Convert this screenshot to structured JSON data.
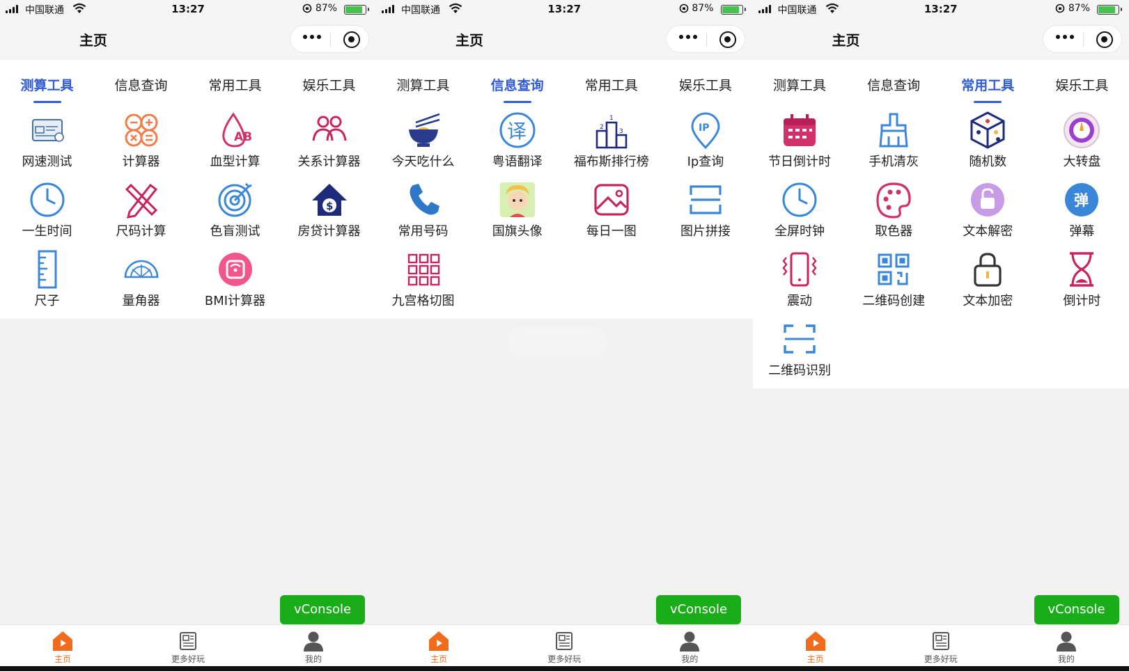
{
  "status_bar": {
    "carrier": "中国联通",
    "time": "13:27",
    "battery": "87%"
  },
  "nav": {
    "title": "主页"
  },
  "tabs": [
    "测算工具",
    "信息查询",
    "常用工具",
    "娱乐工具"
  ],
  "tabbar": {
    "home": "主页",
    "more": "更多好玩",
    "mine": "我的"
  },
  "vconsole": "vConsole",
  "colors": {
    "accent": "#2f5ad8",
    "orange": "#f26b1d",
    "green": "#1aad19"
  },
  "screens": [
    {
      "active_tab": 0,
      "items": [
        {
          "label": "网速测试",
          "icon": "speed-test-icon"
        },
        {
          "label": "计算器",
          "icon": "calculator-icon"
        },
        {
          "label": "血型计算",
          "icon": "blood-type-icon"
        },
        {
          "label": "关系计算器",
          "icon": "relation-icon"
        },
        {
          "label": "一生时间",
          "icon": "clock-icon"
        },
        {
          "label": "尺码计算",
          "icon": "pencil-ruler-icon"
        },
        {
          "label": "色盲测试",
          "icon": "target-icon"
        },
        {
          "label": "房贷计算器",
          "icon": "house-loan-icon"
        },
        {
          "label": "尺子",
          "icon": "ruler-icon"
        },
        {
          "label": "量角器",
          "icon": "protractor-icon"
        },
        {
          "label": "BMI计算器",
          "icon": "scale-icon"
        }
      ]
    },
    {
      "active_tab": 1,
      "items": [
        {
          "label": "今天吃什么",
          "icon": "bowl-icon"
        },
        {
          "label": "粤语翻译",
          "icon": "translate-icon"
        },
        {
          "label": "福布斯排行榜",
          "icon": "podium-icon"
        },
        {
          "label": "Ip查询",
          "icon": "ip-pin-icon"
        },
        {
          "label": "常用号码",
          "icon": "phone-icon"
        },
        {
          "label": "国旗头像",
          "icon": "avatar-flag-icon"
        },
        {
          "label": "每日一图",
          "icon": "picture-icon"
        },
        {
          "label": "图片拼接",
          "icon": "image-join-icon"
        },
        {
          "label": "九宫格切图",
          "icon": "nine-grid-icon"
        }
      ]
    },
    {
      "active_tab": 2,
      "items": [
        {
          "label": "节日倒计时",
          "icon": "calendar-icon"
        },
        {
          "label": "手机清灰",
          "icon": "brush-icon"
        },
        {
          "label": "随机数",
          "icon": "dice-icon"
        },
        {
          "label": "大转盘",
          "icon": "wheel-icon"
        },
        {
          "label": "全屏时钟",
          "icon": "clock-icon"
        },
        {
          "label": "取色器",
          "icon": "palette-icon"
        },
        {
          "label": "文本解密",
          "icon": "unlock-icon"
        },
        {
          "label": "弹幕",
          "icon": "danmaku-icon"
        },
        {
          "label": "震动",
          "icon": "vibrate-icon"
        },
        {
          "label": "二维码创建",
          "icon": "qrcode-icon"
        },
        {
          "label": "文本加密",
          "icon": "lock-icon"
        },
        {
          "label": "倒计时",
          "icon": "hourglass-icon"
        },
        {
          "label": "二维码识别",
          "icon": "scan-icon"
        }
      ]
    }
  ]
}
